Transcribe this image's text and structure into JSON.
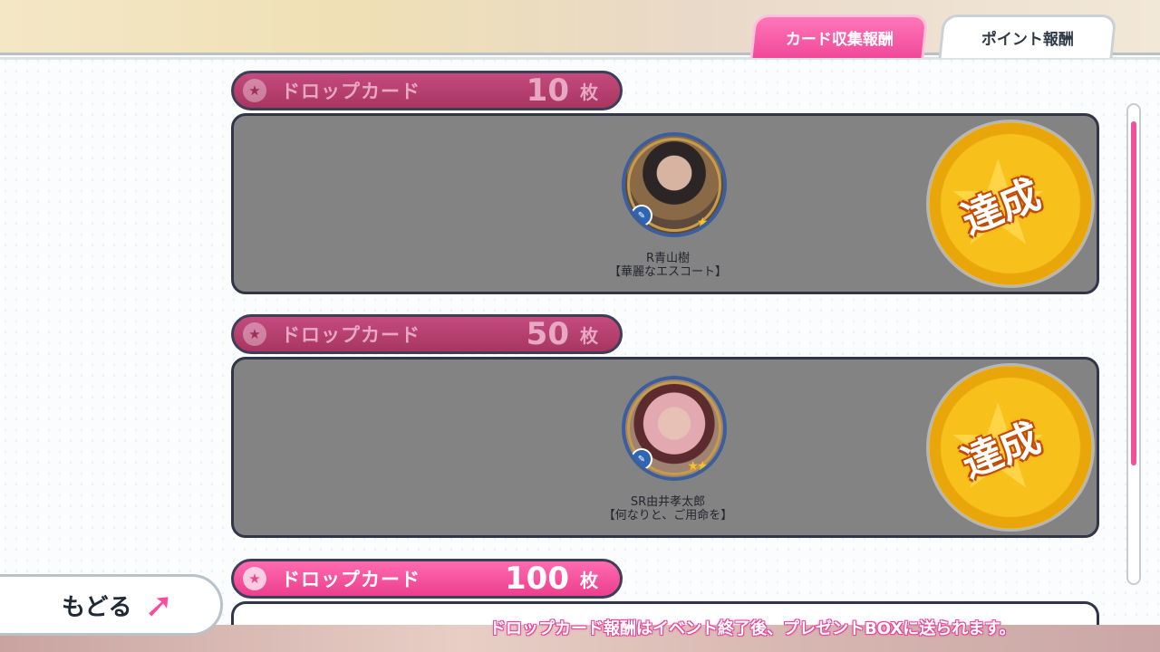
{
  "tabs": {
    "card_collect": "カード収集報酬",
    "points": "ポイント報酬"
  },
  "sections": [
    {
      "title": "ドロップカード",
      "count": "10",
      "unit": "枚",
      "card_line1": "R青山樹",
      "card_line2": "【華麗なエスコート】",
      "status": "達成"
    },
    {
      "title": "ドロップカード",
      "count": "50",
      "unit": "枚",
      "card_line1": "SR由井孝太郎",
      "card_line2": "【何なりと、ご用命を】",
      "status": "達成"
    },
    {
      "title": "ドロップカード",
      "count": "100",
      "unit": "枚"
    }
  ],
  "back_button": {
    "label": "もどる"
  },
  "notice": "ドロップカード報酬はイベント終了後、プレゼントBOXに送られます。",
  "colors": {
    "accent_pink": "#f0489a",
    "header_dim": "#a8365f",
    "achieved_gold": "#f7c01a"
  },
  "icons": {
    "tab_active": "pink-tab",
    "section": "star-icon",
    "achieved": "star-badge",
    "back": "curved-arrow-icon"
  }
}
